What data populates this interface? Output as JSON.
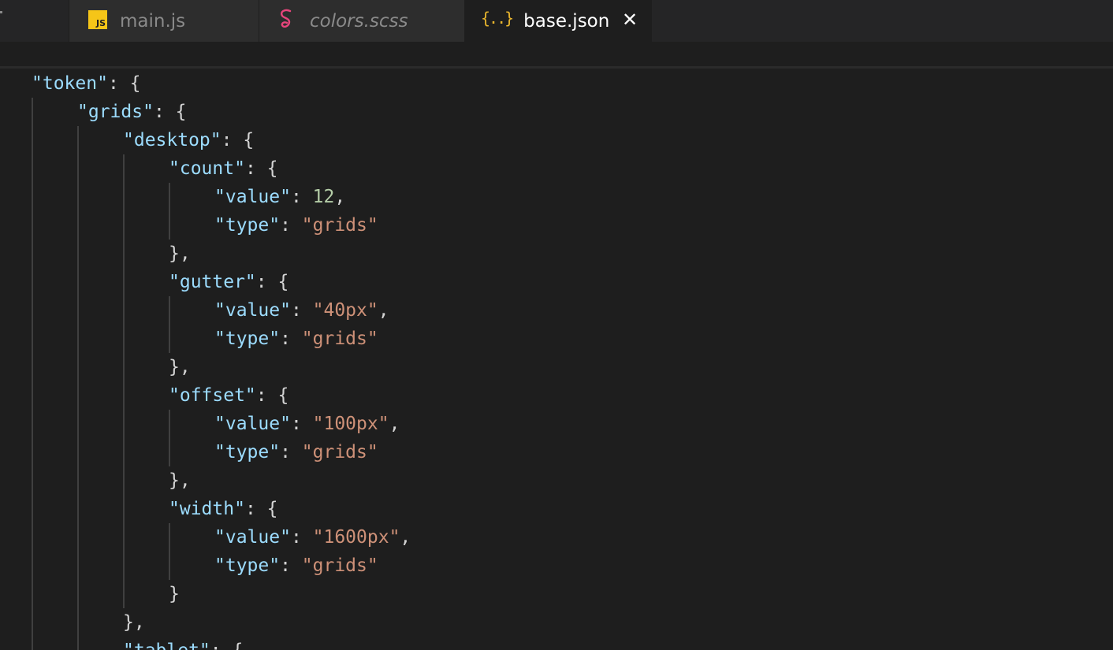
{
  "tabs": [
    {
      "label": "main.js",
      "icon": "js-file-icon",
      "active": false
    },
    {
      "label": "colors.scss",
      "icon": "sass-file-icon",
      "active": false
    },
    {
      "label": "base.json",
      "icon": "json-file-icon",
      "active": true
    }
  ],
  "editor": {
    "language": "json",
    "colors": {
      "key": "#9cdcfe",
      "string": "#ce9178",
      "number": "#b5cea8",
      "punctuation": "#d4d4d4",
      "background": "#1e1e1e"
    },
    "lines": [
      {
        "indent": 0,
        "key": "\"token\"",
        "rest": ": {"
      },
      {
        "indent": 1,
        "key": "\"grids\"",
        "rest": ": {"
      },
      {
        "indent": 2,
        "key": "\"desktop\"",
        "rest": ": {"
      },
      {
        "indent": 3,
        "key": "\"count\"",
        "rest": ": {"
      },
      {
        "indent": 4,
        "key": "\"value\"",
        "sep": ": ",
        "num": "12",
        "tail": ","
      },
      {
        "indent": 4,
        "key": "\"type\"",
        "sep": ": ",
        "str": "\"grids\"",
        "tail": ""
      },
      {
        "indent": 3,
        "punct": "},"
      },
      {
        "indent": 3,
        "key": "\"gutter\"",
        "rest": ": {"
      },
      {
        "indent": 4,
        "key": "\"value\"",
        "sep": ": ",
        "str": "\"40px\"",
        "tail": ","
      },
      {
        "indent": 4,
        "key": "\"type\"",
        "sep": ": ",
        "str": "\"grids\"",
        "tail": ""
      },
      {
        "indent": 3,
        "punct": "},"
      },
      {
        "indent": 3,
        "key": "\"offset\"",
        "rest": ": {"
      },
      {
        "indent": 4,
        "key": "\"value\"",
        "sep": ": ",
        "str": "\"100px\"",
        "tail": ","
      },
      {
        "indent": 4,
        "key": "\"type\"",
        "sep": ": ",
        "str": "\"grids\"",
        "tail": ""
      },
      {
        "indent": 3,
        "punct": "},"
      },
      {
        "indent": 3,
        "key": "\"width\"",
        "rest": ": {"
      },
      {
        "indent": 4,
        "key": "\"value\"",
        "sep": ": ",
        "str": "\"1600px\"",
        "tail": ","
      },
      {
        "indent": 4,
        "key": "\"type\"",
        "sep": ": ",
        "str": "\"grids\"",
        "tail": ""
      },
      {
        "indent": 3,
        "punct": "}"
      },
      {
        "indent": 2,
        "punct": "},"
      },
      {
        "indent": 2,
        "key": "\"tablet\"",
        "rest": ": {"
      }
    ]
  }
}
